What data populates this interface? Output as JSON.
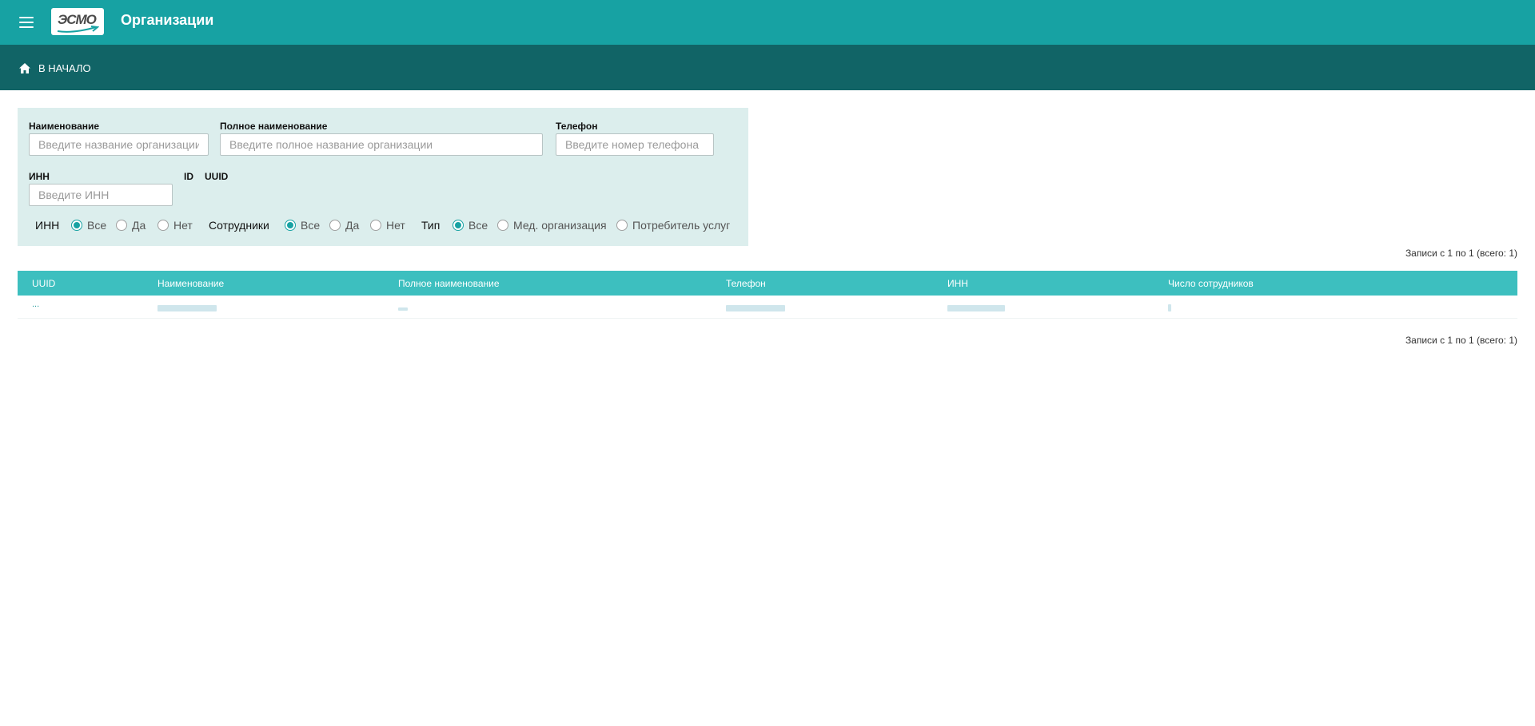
{
  "header": {
    "logo_text": "ЭСМО",
    "title": "Организации"
  },
  "breadcrumb": {
    "home_label": "В НАЧАЛО"
  },
  "filters": {
    "name": {
      "label": "Наименование",
      "placeholder": "Введите название организации",
      "value": ""
    },
    "full_name": {
      "label": "Полное наименование",
      "placeholder": "Введите полное название организации",
      "value": ""
    },
    "phone": {
      "label": "Телефон",
      "placeholder": "Введите номер телефона",
      "value": ""
    },
    "inn": {
      "label": "ИНН",
      "placeholder": "Введите ИНН",
      "value": ""
    },
    "id_label": "ID",
    "uuid_label": "UUID",
    "radio_groups": [
      {
        "label": "ИНН",
        "options": [
          "Все",
          "Да",
          "Нет"
        ],
        "selected": "Все"
      },
      {
        "label": "Сотрудники",
        "options": [
          "Все",
          "Да",
          "Нет"
        ],
        "selected": "Все"
      },
      {
        "label": "Тип",
        "options": [
          "Все",
          "Мед. организация",
          "Потребитель услуг"
        ],
        "selected": "Все"
      }
    ]
  },
  "records_info": "Записи с 1 по 1 (всего: 1)",
  "table": {
    "columns": [
      "UUID",
      "Наименование",
      "Полное наименование",
      "Телефон",
      "ИНН",
      "Число сотрудников"
    ],
    "rows": [
      {
        "uuid": "...",
        "name": "",
        "full_name": "",
        "phone": "",
        "inn": "",
        "employees": ""
      }
    ]
  },
  "colors": {
    "topbar": "#17a2a3",
    "subbar": "#116466",
    "filter_bg": "#dceeed",
    "table_header": "#3dbfbf",
    "accent": "#17a2a3"
  },
  "icons": [
    "menu-icon",
    "home-icon"
  ]
}
